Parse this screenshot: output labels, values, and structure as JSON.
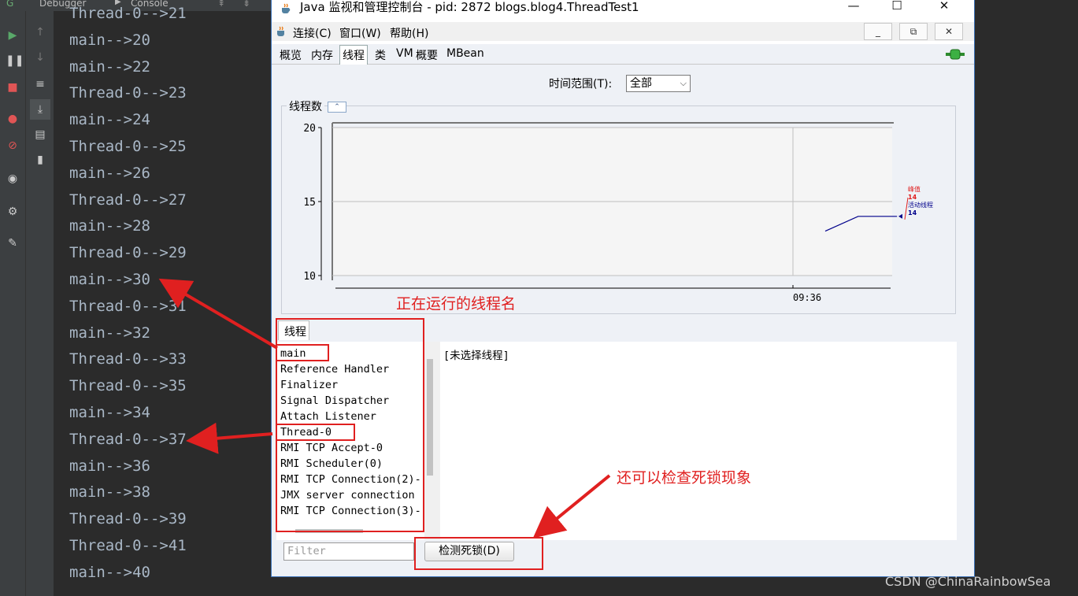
{
  "ide": {
    "tabs": [
      "Debugger",
      "Console"
    ],
    "console_lines": [
      "Thread-0-->21",
      "main-->20",
      "main-->22",
      "Thread-0-->23",
      "main-->24",
      "Thread-0-->25",
      "main-->26",
      "Thread-0-->27",
      "main-->28",
      "Thread-0-->29",
      "main-->30",
      "Thread-0-->31",
      "main-->32",
      "Thread-0-->33",
      "Thread-0-->35",
      "main-->34",
      "Thread-0-->37",
      "main-->36",
      "main-->38",
      "Thread-0-->39",
      "Thread-0-->41",
      "main-->40"
    ]
  },
  "jconsole": {
    "title": "Java 监视和管理控制台 - pid: 2872 blogs.blog4.ThreadTest1",
    "window_controls": {
      "minimize": "—",
      "maximize": "☐",
      "close": "✕"
    },
    "menu": [
      "连接(C)",
      "窗口(W)",
      "帮助(H)"
    ],
    "inner_controls": {
      "minimize": "_",
      "restore": "⧉",
      "close": "✕"
    },
    "tabs": [
      "概览",
      "内存",
      "线程",
      "类",
      "VM",
      "概要",
      "MBean"
    ],
    "active_tab": "线程",
    "time_range": {
      "label": "时间范围(T):",
      "value": "全部"
    },
    "chart_panel_title": "线程数",
    "threads_tab": "线程",
    "threads": [
      "main",
      "Reference Handler",
      "Finalizer",
      "Signal Dispatcher",
      "Attach Listener",
      "Thread-0",
      "RMI TCP Accept-0",
      "RMI Scheduler(0)",
      "RMI TCP Connection(2)-",
      "JMX server connection",
      "RMI TCP Connection(3)-"
    ],
    "detail_text": "[未选择线程]",
    "filter_placeholder": "Filter",
    "deadlock_button": "检测死锁(D)"
  },
  "chart_data": {
    "type": "line",
    "yticks": [
      10,
      15,
      20
    ],
    "ylim": [
      10,
      20
    ],
    "xticks": [
      "09:36"
    ],
    "series": [
      {
        "name": "活动线程",
        "color": "#00008b",
        "points": [
          [
            0.0,
            13
          ],
          [
            0.22,
            14
          ],
          [
            0.48,
            14
          ]
        ]
      }
    ],
    "legend": [
      {
        "label": "峰值",
        "value": "14",
        "color": "#e02020"
      },
      {
        "label": "活动线程",
        "value": "14",
        "color": "#00008b"
      }
    ]
  },
  "annotations": {
    "running_threads": "正在运行的线程名",
    "deadlock_check": "还可以检查死锁现象"
  },
  "watermark": "CSDN @ChinaRainbowSea",
  "colors": {
    "annotation_red": "#e02020",
    "console_text": "#a9b7c6",
    "ide_bg": "#2b2b2b"
  }
}
